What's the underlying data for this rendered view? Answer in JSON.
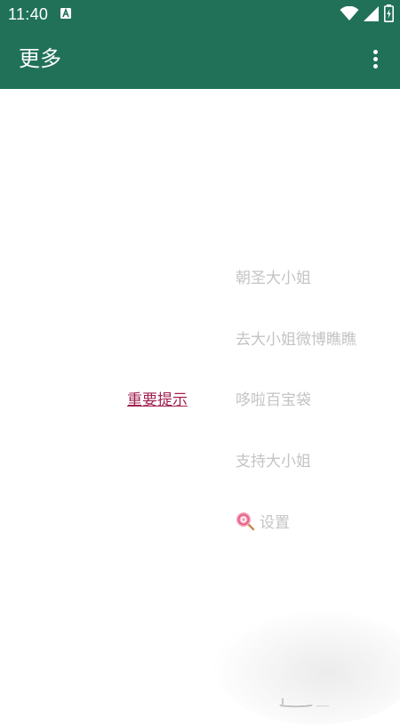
{
  "status_bar": {
    "time": "11:40",
    "notification_icon": "a-badge-icon",
    "wifi_icon": "wifi-icon",
    "signal_icon": "cell-signal-icon",
    "battery_icon": "battery-charging-icon",
    "background": "#217159"
  },
  "app_bar": {
    "title": "更多",
    "menu_icon": "more-vert-icon",
    "background": "#217159"
  },
  "main": {
    "notice_link": "重要提示",
    "menu": [
      {
        "label": "朝圣大小姐"
      },
      {
        "label": "去大小姐微博瞧瞧"
      },
      {
        "label": "哆啦百宝袋"
      },
      {
        "label": "支持大小姐"
      },
      {
        "label": "设置",
        "icon": "lollipop-icon"
      }
    ],
    "colors": {
      "link": "#a1204f",
      "menu_text": "#c4c4c4"
    }
  }
}
